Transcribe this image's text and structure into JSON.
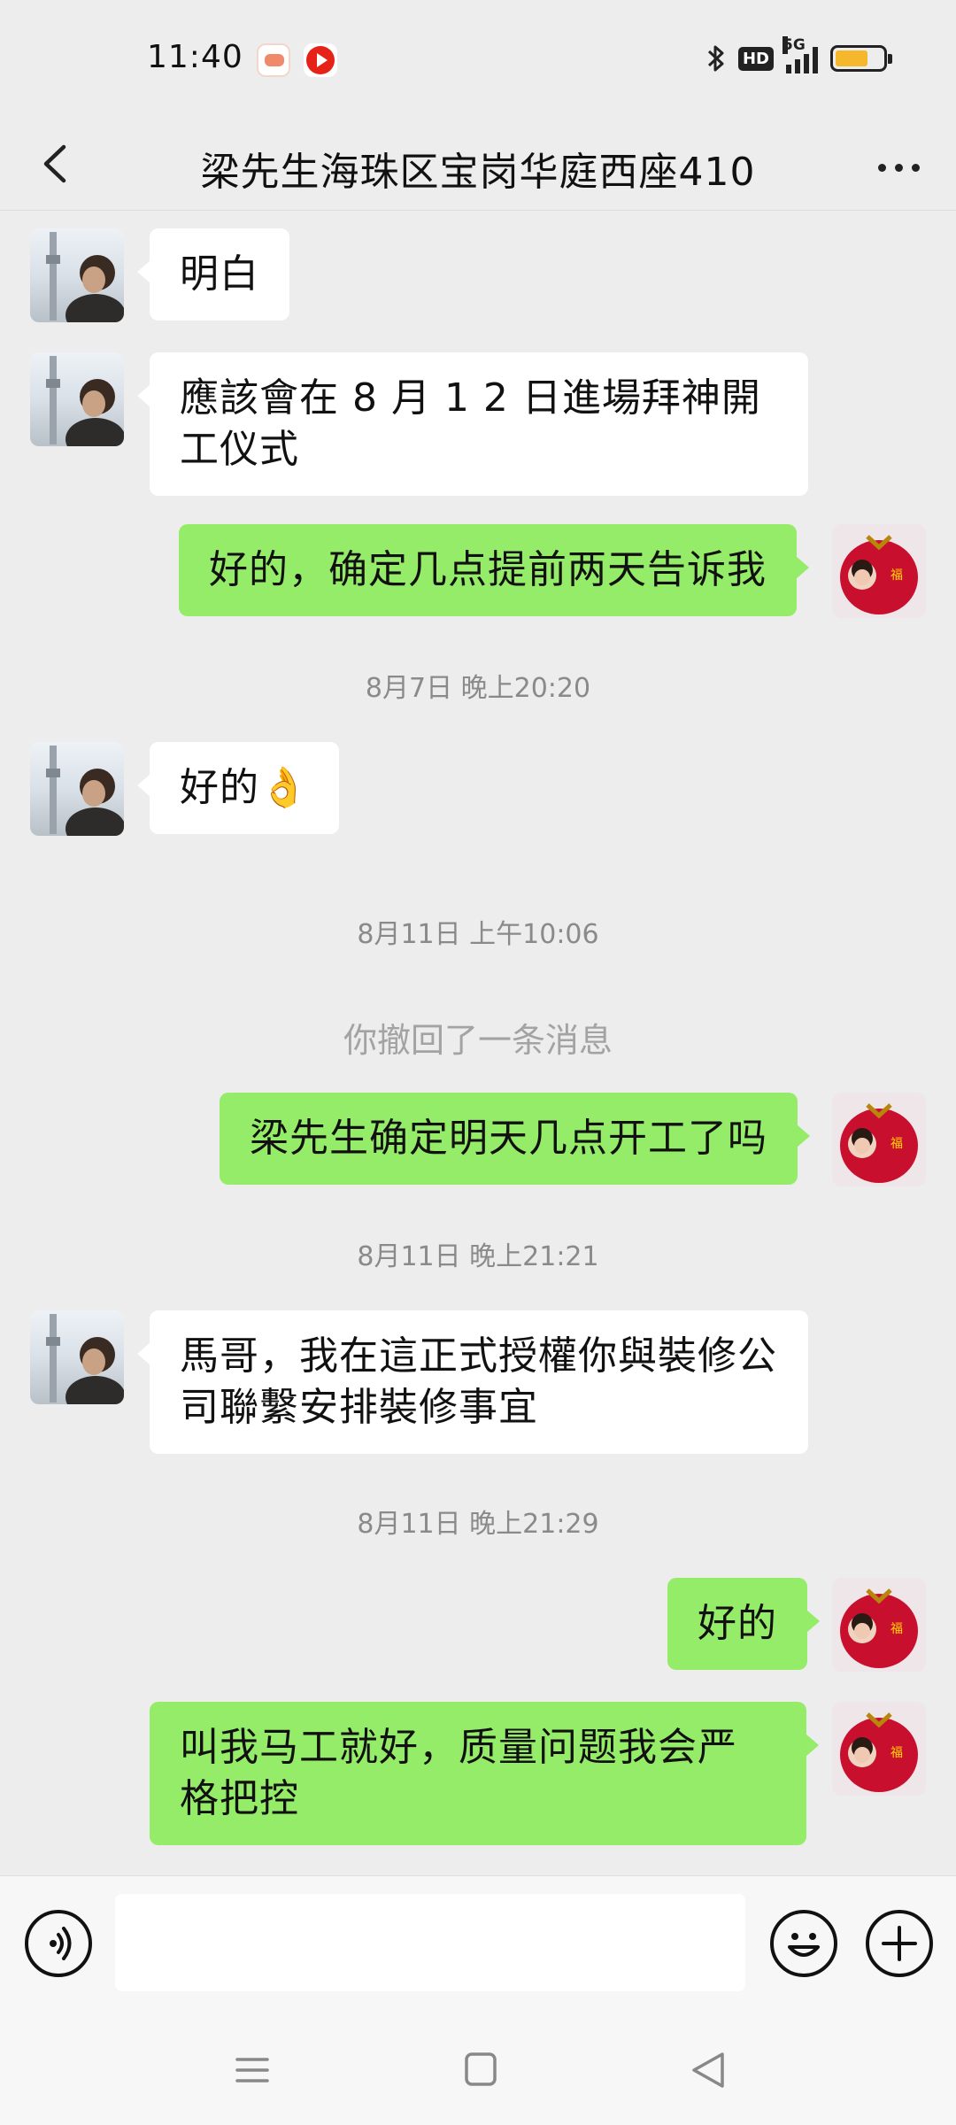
{
  "status_bar": {
    "time": "11:40",
    "network": "5G",
    "hd_badge": "HD",
    "battery_level": 0.7,
    "icons": [
      "game-app-icon",
      "video-app-icon",
      "bluetooth-icon",
      "hd-icon",
      "signal-icon",
      "battery-icon"
    ]
  },
  "header": {
    "title": "梁先生海珠区宝岗华庭西座410",
    "icons": [
      "back-icon",
      "more-icon"
    ]
  },
  "messages": [
    {
      "side": "in",
      "text": "明白"
    },
    {
      "side": "in",
      "text": "應該會在 8 月 1 2 日進場拜神開工仪式"
    },
    {
      "side": "out",
      "text": "好的，确定几点提前两天告诉我"
    },
    {
      "side": "in",
      "text": "好的👌"
    },
    {
      "side": "out",
      "text": "梁先生确定明天几点开工了吗"
    },
    {
      "side": "in",
      "text": "馬哥，我在這正式授權你與裝修公司聯繫安排裝修事宜"
    },
    {
      "side": "out",
      "text": "好的"
    },
    {
      "side": "out",
      "text": "叫我马工就好，质量问题我会严格把控"
    }
  ],
  "timestamps": [
    "8月7日 晚上20:20",
    "8月11日 上午10:06",
    "8月11日 晚上21:21",
    "8月11日 晚上21:29"
  ],
  "system_notice": "你撤回了一条消息",
  "input_bar": {
    "placeholder": "",
    "icons": [
      "voice-icon",
      "emoji-icon",
      "plus-icon"
    ]
  },
  "nav_bar": {
    "icons": [
      "menu-icon",
      "home-icon",
      "back-triangle-icon"
    ]
  },
  "colors": {
    "background": "#ededed",
    "incoming_bubble": "#ffffff",
    "outgoing_bubble": "#95ec69",
    "battery_fill": "#f5b72b"
  }
}
